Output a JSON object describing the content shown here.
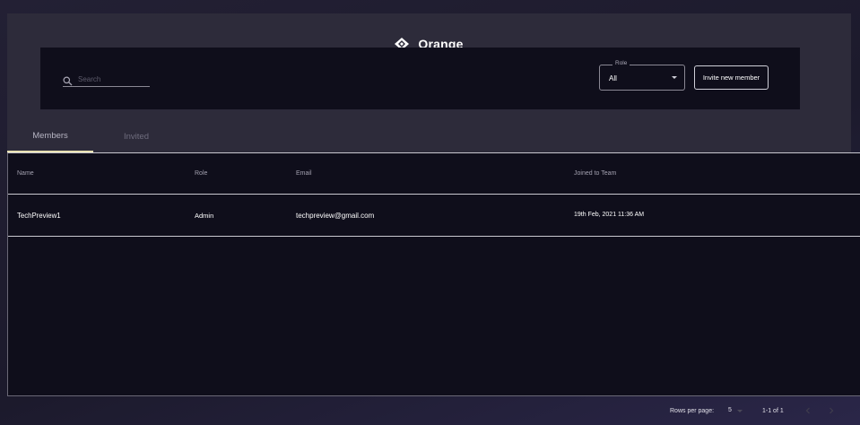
{
  "header": {
    "title": "Orange",
    "logo_icon": "diamond-logo-icon"
  },
  "toolbar": {
    "search_placeholder": "Search",
    "role_label": "Role",
    "role_value": "All",
    "invite_label": "Invite new member"
  },
  "tabs": [
    {
      "label": "Members",
      "active": true
    },
    {
      "label": "Invited",
      "active": false
    }
  ],
  "table": {
    "columns": [
      "Name",
      "Role",
      "Email",
      "Joined to Team"
    ],
    "rows": [
      {
        "name": "TechPreview1",
        "role": "Admin",
        "email": "techpreview@gmail.com",
        "joined": "19th Feb, 2021 11:36 AM"
      }
    ]
  },
  "pagination": {
    "rows_per_page_label": "Rows per page:",
    "rows_per_page": "5",
    "range": "1-1 of 1"
  },
  "colors": {
    "accent": "#e9e2b4",
    "panel": "#2d2b3a",
    "surface": "#0f0e1b"
  }
}
